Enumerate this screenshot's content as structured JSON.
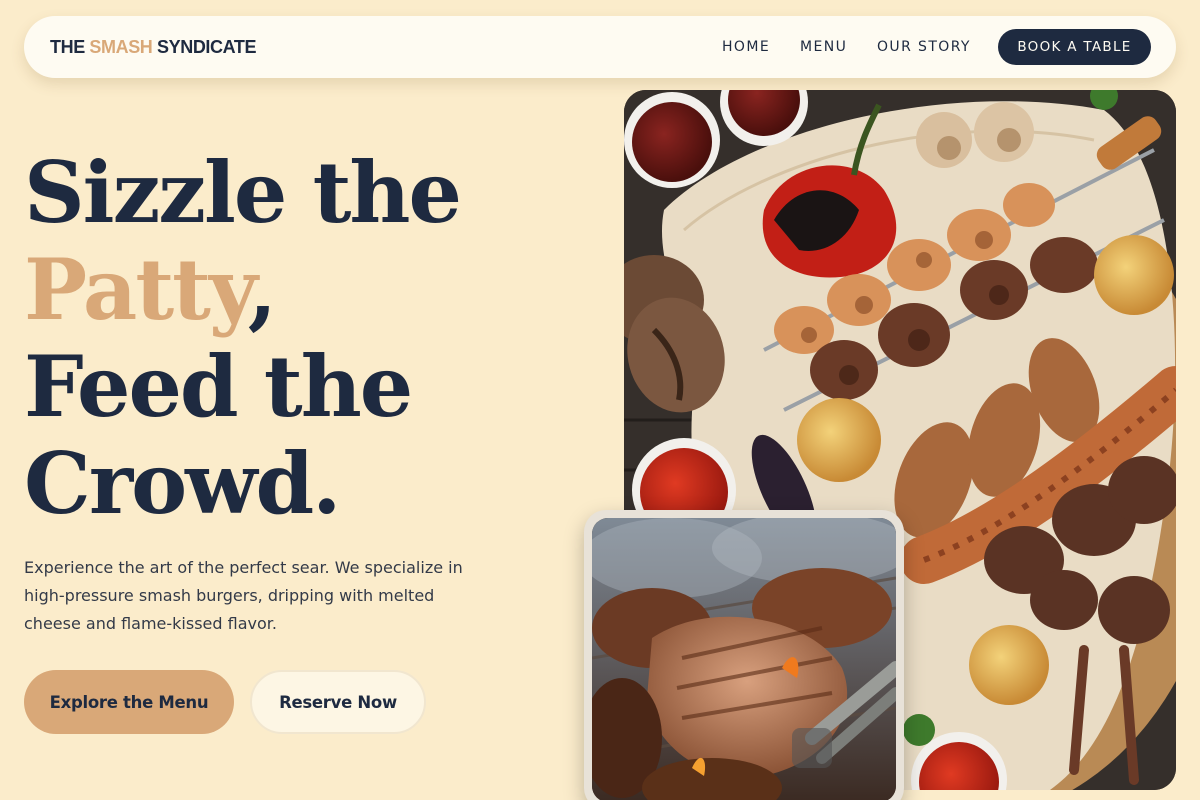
{
  "nav": {
    "logo_part1": "THE ",
    "logo_accent": "SMASH",
    "logo_part2": " SYNDICATE",
    "links": [
      "HOME",
      "MENU",
      "OUR STORY"
    ],
    "cta": "BOOK A TABLE"
  },
  "hero": {
    "line1": "Sizzle the",
    "line2_accent": "Patty",
    "line2_punct": ",",
    "line3": "Feed the",
    "line4": "Crowd.",
    "description": "Experience the art of the perfect sear. We specialize in high-pressure smash burgers, dripping with melted cheese and flame-kissed flavor.",
    "primary_button": "Explore the Menu",
    "secondary_button": "Reserve Now"
  },
  "colors": {
    "background": "#fbeccb",
    "navy": "#1e2a40",
    "accent": "#d9a878",
    "nav_bg": "#fefbf2"
  },
  "images": {
    "main": "grilled-kebab-platter-photo",
    "secondary": "grill-meat-tongs-photo"
  }
}
